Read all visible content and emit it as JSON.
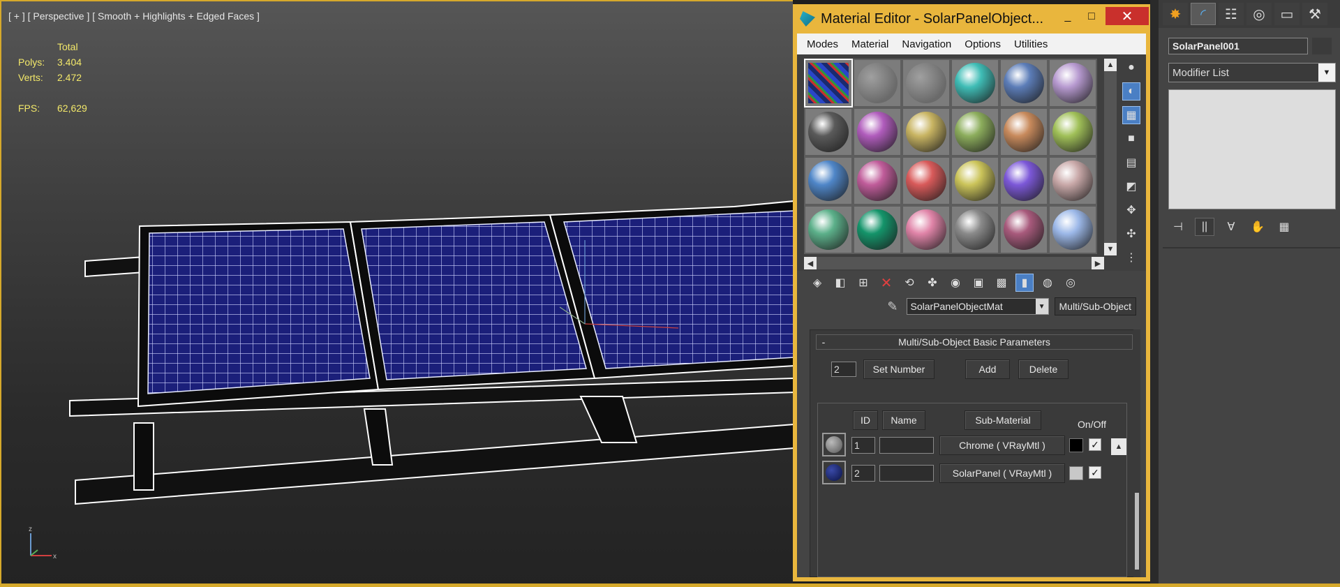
{
  "viewport": {
    "label": "[ + ] [ Perspective ] [ Smooth + Highlights + Edged Faces ]",
    "stats": {
      "header": "Total",
      "polys_label": "Polys:",
      "polys_value": "3.404",
      "verts_label": "Verts:",
      "verts_value": "2.472",
      "fps_label": "FPS:",
      "fps_value": "62,629"
    },
    "gizmo": {
      "z": "z",
      "x": "x"
    }
  },
  "material_editor": {
    "title": "Material Editor - SolarPanelObject...",
    "window_buttons": {
      "minimize": "_",
      "maximize": "□",
      "close": "✕"
    },
    "menus": [
      "Modes",
      "Material",
      "Navigation",
      "Options",
      "Utilities"
    ],
    "slots": [
      {
        "color": "#1a2a6e",
        "active": true
      },
      {
        "color": "#8a8a8a"
      },
      {
        "color": "#8a8a8a"
      },
      {
        "color": "#3fbdb6"
      },
      {
        "color": "#5c7db8"
      },
      {
        "color": "#b79ad0"
      },
      {
        "color": "#5a5a5a"
      },
      {
        "color": "#b05cbc"
      },
      {
        "color": "#c8b462"
      },
      {
        "color": "#8cad5c"
      },
      {
        "color": "#c88a5c"
      },
      {
        "color": "#a0c058"
      },
      {
        "color": "#4f86c8"
      },
      {
        "color": "#c05c9a"
      },
      {
        "color": "#d85a5a"
      },
      {
        "color": "#cbc45a"
      },
      {
        "color": "#7c58d8"
      },
      {
        "color": "#c8a8a8"
      },
      {
        "color": "#5cb08a"
      },
      {
        "color": "#14946a"
      },
      {
        "color": "#e084a8"
      },
      {
        "color": "#8a8a8a"
      },
      {
        "color": "#a85a7c"
      },
      {
        "color": "#9cb8e8"
      }
    ],
    "material_name": "SolarPanelObjectMat",
    "material_type": "Multi/Sub-Object",
    "rollout": {
      "title": "Multi/Sub-Object Basic Parameters",
      "collapse": "-",
      "count": "2",
      "set_number": "Set Number",
      "add": "Add",
      "delete": "Delete",
      "columns": {
        "id": "ID",
        "name": "Name",
        "sub_material": "Sub-Material",
        "on_off": "On/Off"
      },
      "rows": [
        {
          "id": "1",
          "name": "",
          "material": "Chrome  ( VRayMtl )",
          "swatch": "#000000",
          "thumb": "#8a8a8a"
        },
        {
          "id": "2",
          "name": "",
          "material": "SolarPanel  ( VRayMtl )",
          "swatch": "#c8c8c8",
          "thumb": "#1a2a6e"
        }
      ]
    }
  },
  "command_panel": {
    "object_name": "SolarPanel001",
    "modifier_list": "Modifier List"
  },
  "colors": {
    "accent": "#e9b63d",
    "panel": "#444444"
  }
}
